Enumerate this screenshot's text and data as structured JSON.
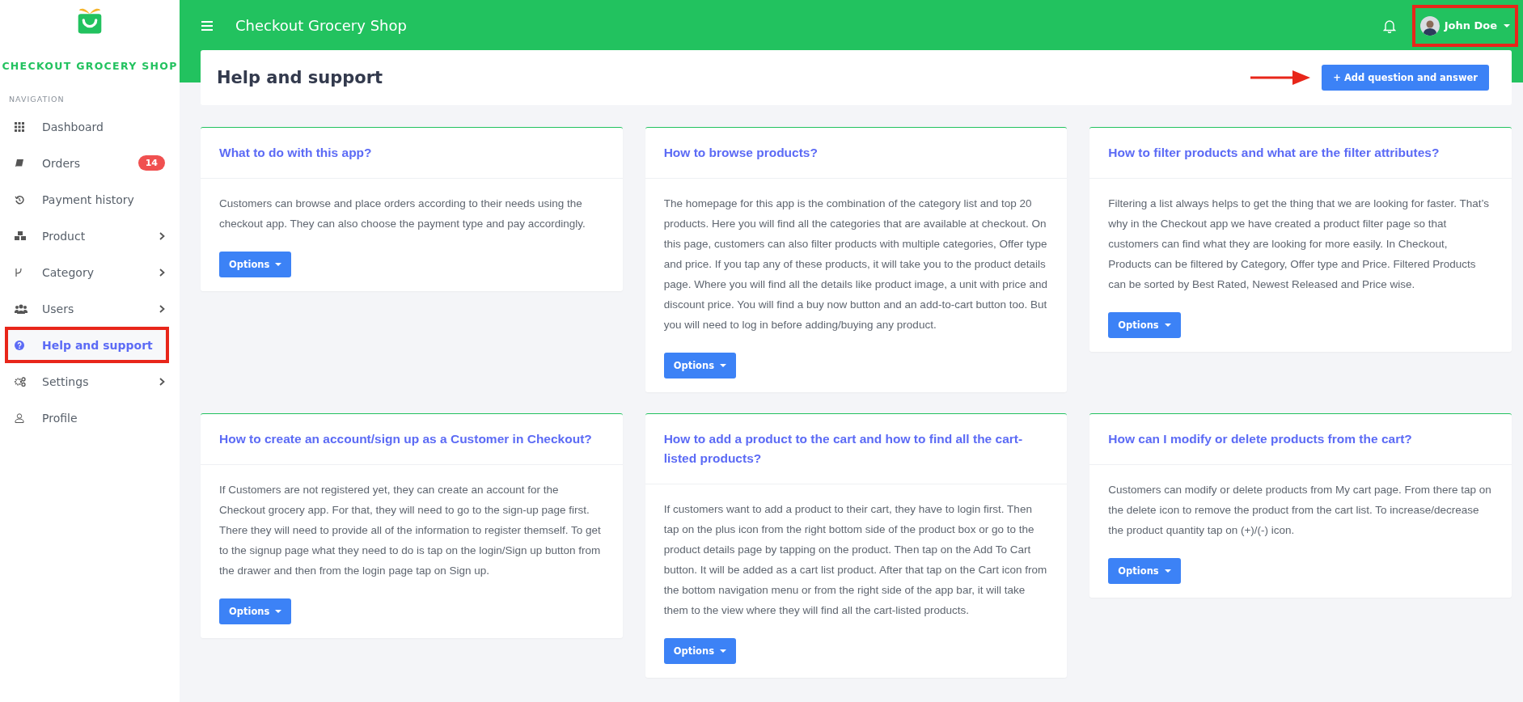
{
  "brand": {
    "name": "CHECKOUT GROCERY SHOP"
  },
  "sidebar": {
    "heading": "NAVIGATION",
    "items": [
      {
        "label": "Dashboard",
        "selected": false,
        "highlighted": false
      },
      {
        "label": "Orders",
        "badge": "14",
        "selected": false,
        "highlighted": false
      },
      {
        "label": "Payment history",
        "selected": false,
        "highlighted": false
      },
      {
        "label": "Product",
        "expandable": true,
        "selected": false,
        "highlighted": false
      },
      {
        "label": "Category",
        "expandable": true,
        "selected": false,
        "highlighted": false
      },
      {
        "label": "Users",
        "expandable": true,
        "selected": false,
        "highlighted": false
      },
      {
        "label": "Help and support",
        "selected": true,
        "highlighted": true
      },
      {
        "label": "Settings",
        "expandable": true,
        "selected": false,
        "highlighted": false
      },
      {
        "label": "Profile",
        "selected": false,
        "highlighted": false
      }
    ]
  },
  "topbar": {
    "title": "Checkout Grocery Shop",
    "user": {
      "name": "John Doe",
      "highlighted": true
    }
  },
  "page": {
    "title": "Help and support",
    "add_button": {
      "label": "+ Add question and answer",
      "pointed_at": true
    }
  },
  "faq_cards": [
    {
      "question": "What to do with this app?",
      "answer": "Customers can browse and place orders according to their needs using the checkout app. They can also choose the payment type and pay accordingly.",
      "button": "Options"
    },
    {
      "question": "How to browse products?",
      "answer": "The homepage for this app is the combination of the category list and top 20 products. Here you will find all the categories that are available at checkout. On this page, customers can also filter products with multiple categories, Offer type and price. If you tap any of these products, it will take you to the product details page. Where you will find all the details like product image, a unit with price and discount price. You will find a buy now button and an add-to-cart button too. But you will need to log in before adding/buying any product.",
      "button": "Options"
    },
    {
      "question": "How to filter products and what are the filter attributes?",
      "answer": "Filtering a list always helps to get the thing that we are looking for faster. That’s why in the Checkout app we have created a product filter page so that customers can find what they are looking for more easily. In Checkout, Products can be filtered by Category, Offer type and Price. Filtered Products can be sorted by Best Rated, Newest Released and Price wise.",
      "button": "Options"
    },
    {
      "question": "How to create an account/sign up as a Customer in Checkout?",
      "answer": "If Customers are not registered yet, they can create an account for the Checkout grocery app. For that, they will need to go to the sign-up page first. There they will need to provide all of the information to register themself. To get to the signup page what they need to do is tap on the login/Sign up button from the drawer and then from the login page tap on Sign up.",
      "button": "Options"
    },
    {
      "question": "How to add a product to the cart and how to find all the cart-listed products?",
      "answer": "If customers want to add a product to their cart, they have to login first. Then tap on the plus icon from the right bottom side of the product box or go to the product details page by tapping on the product. Then tap on the Add To Cart button. It will be added as a cart list product. After that tap on the Cart icon from the bottom navigation menu or from the right side of the app bar, it will take them to the view where they will find all the cart-listed products.",
      "button": "Options"
    },
    {
      "question": "How can I modify or delete products from the cart?",
      "answer": "Customers can modify or delete products from My cart page. From there tap on the delete icon to remove the product from the cart list. To increase/decrease the product quantity tap on (+)/(-) icon.",
      "button": "Options"
    }
  ]
}
